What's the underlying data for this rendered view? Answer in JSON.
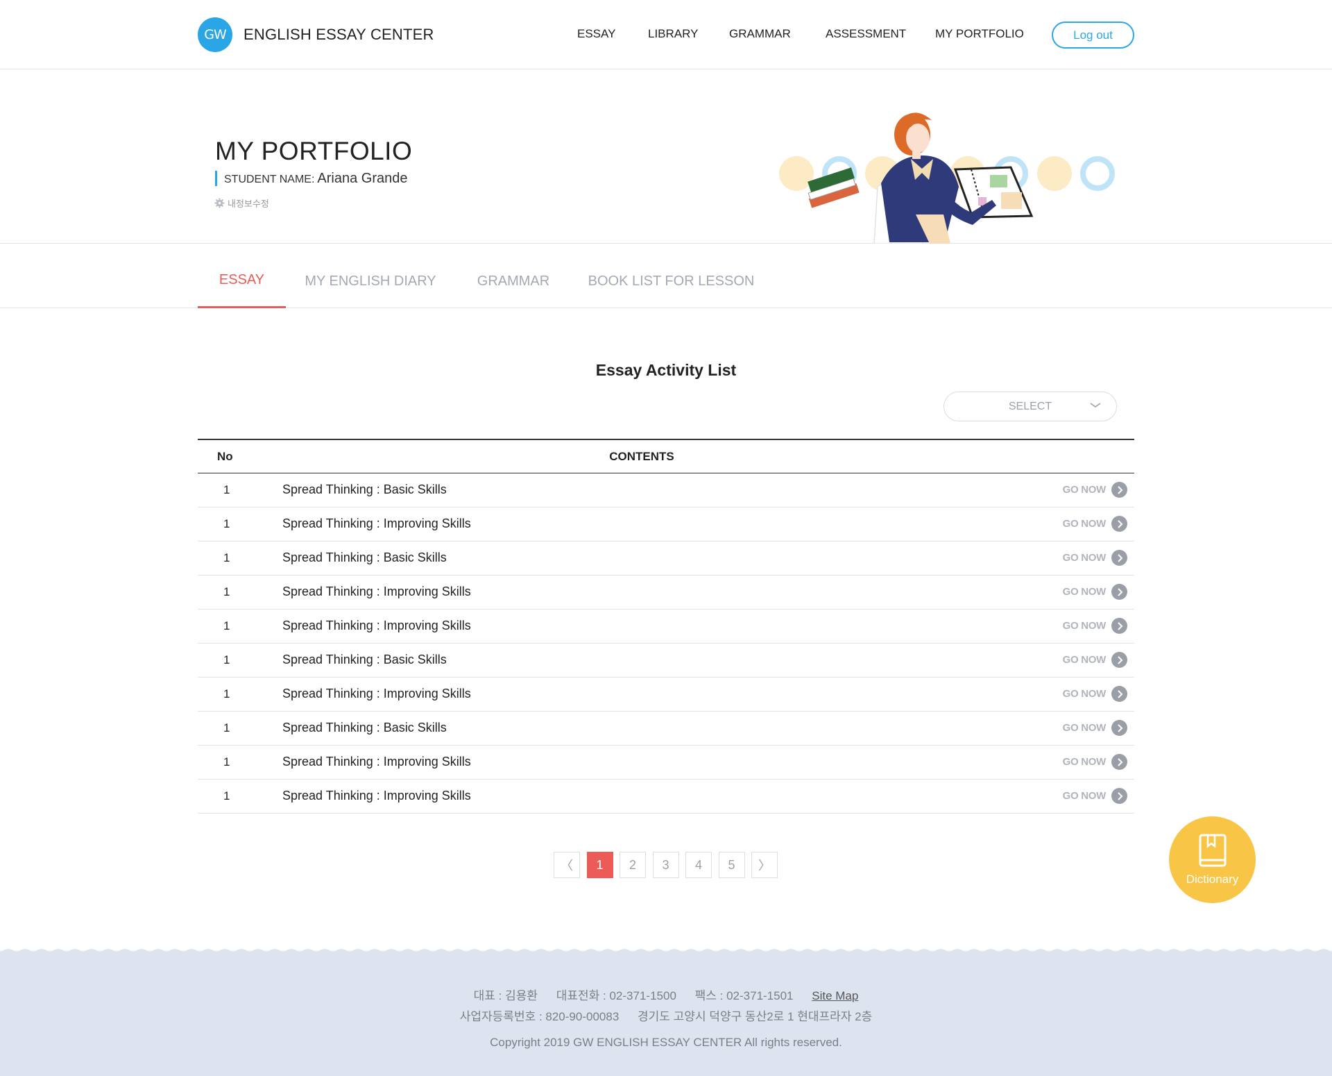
{
  "header": {
    "logo_mark": "GW",
    "logo_text": "ENGLISH ESSAY CENTER",
    "nav": [
      "ESSAY",
      "LIBRARY",
      "GRAMMAR",
      "ASSESSMENT",
      "MY PORTFOLIO"
    ],
    "logout_label": "Log out",
    "accent_color": "#2aa6e6"
  },
  "hero": {
    "title": "MY PORTFOLIO",
    "student_label": "STUDENT NAME:",
    "student_name": "Ariana Grande",
    "edit_label": "내정보수정"
  },
  "tabs": [
    "ESSAY",
    "MY ENGLISH DIARY",
    "GRAMMAR",
    "BOOK LIST FOR LESSON"
  ],
  "active_tab": "ESSAY",
  "list": {
    "title": "Essay Activity List",
    "select_label": "SELECT",
    "columns": {
      "no": "No",
      "contents": "CONTENTS"
    },
    "go_label": "GO NOW",
    "rows": [
      {
        "no": "1",
        "content": "Spread Thinking : Basic Skills"
      },
      {
        "no": "1",
        "content": "Spread Thinking : Improving Skills"
      },
      {
        "no": "1",
        "content": "Spread Thinking : Basic Skills"
      },
      {
        "no": "1",
        "content": "Spread Thinking : Improving Skills"
      },
      {
        "no": "1",
        "content": "Spread Thinking : Improving Skills"
      },
      {
        "no": "1",
        "content": "Spread Thinking : Basic Skills"
      },
      {
        "no": "1",
        "content": "Spread Thinking : Improving Skills"
      },
      {
        "no": "1",
        "content": "Spread Thinking : Basic Skills"
      },
      {
        "no": "1",
        "content": "Spread Thinking : Improving Skills"
      },
      {
        "no": "1",
        "content": "Spread Thinking : Improving Skills"
      }
    ]
  },
  "pagination": {
    "prev": "〈",
    "next": "〉",
    "pages": [
      "1",
      "2",
      "3",
      "4",
      "5"
    ],
    "current": "1",
    "active_color": "#ec5b57"
  },
  "dictionary": {
    "label": "Dictionary",
    "icon": "book-icon",
    "color": "#f9c547"
  },
  "footer": {
    "ceo": "대표 : 김용환",
    "phone": "대표전화 : 02-371-1500",
    "fax": "팩스 : 02-371-1501",
    "sitemap": "Site Map",
    "business_no": "사업자등록번호 : 820-90-00083",
    "address": "경기도 고양시 덕양구 동산2로 1 현대프라자 2층",
    "copyright": "Copyright 2019 GW ENGLISH ESSAY CENTER All rights reserved.",
    "background": "#dde3ef"
  }
}
